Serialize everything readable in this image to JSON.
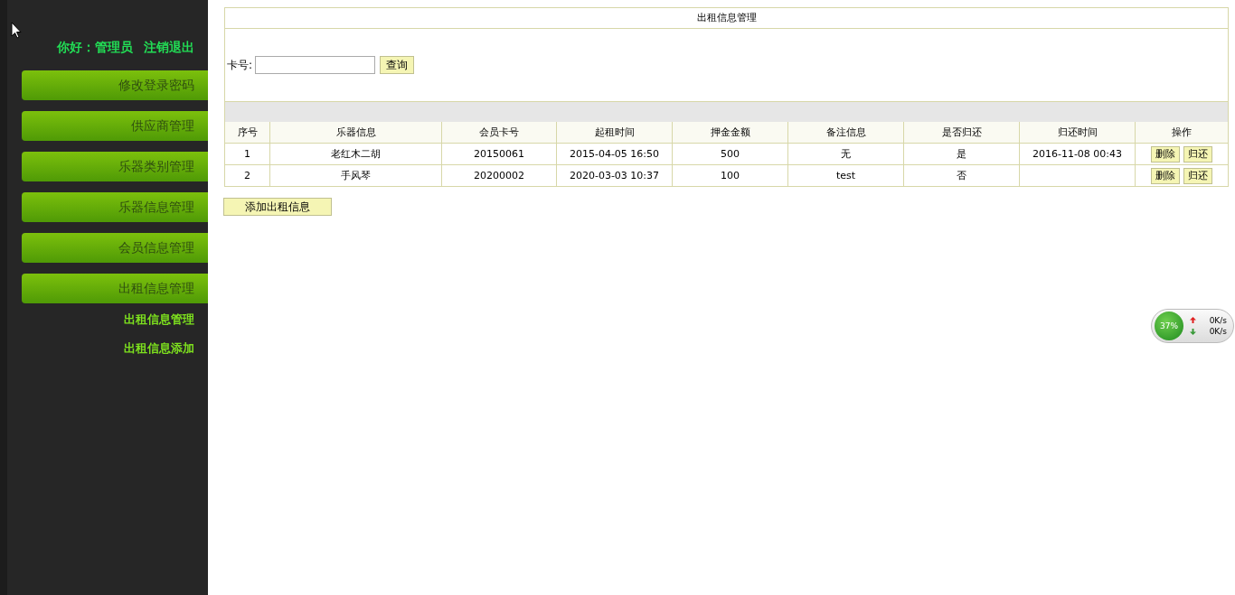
{
  "sidebar": {
    "greeting": "你好：管理员",
    "logout": "注销退出",
    "menu": [
      {
        "label": "修改登录密码"
      },
      {
        "label": "供应商管理"
      },
      {
        "label": "乐器类别管理"
      },
      {
        "label": "乐器信息管理"
      },
      {
        "label": "会员信息管理"
      },
      {
        "label": "出租信息管理",
        "children": [
          {
            "label": "出租信息管理"
          },
          {
            "label": "出租信息添加"
          }
        ]
      }
    ]
  },
  "panel": {
    "title": "出租信息管理",
    "search": {
      "label": "卡号:",
      "button": "查询"
    },
    "table": {
      "columns": [
        "序号",
        "乐器信息",
        "会员卡号",
        "起租时间",
        "押金金额",
        "备注信息",
        "是否归还",
        "归还时间",
        "操作"
      ],
      "rows": [
        {
          "cells": [
            "1",
            "老红木二胡",
            "20150061",
            "2015-04-05 16:50",
            "500",
            "无",
            "是",
            "2016-11-08 00:43"
          ],
          "actions": [
            "删除",
            "归还"
          ]
        },
        {
          "cells": [
            "2",
            "手风琴",
            "20200002",
            "2020-03-03 10:37",
            "100",
            "test",
            "否",
            ""
          ],
          "actions": [
            "删除",
            "归还"
          ]
        }
      ]
    },
    "add_button": "添加出租信息"
  },
  "net_widget": {
    "percent": "37%",
    "up": "0K/s",
    "down": "0K/s"
  }
}
